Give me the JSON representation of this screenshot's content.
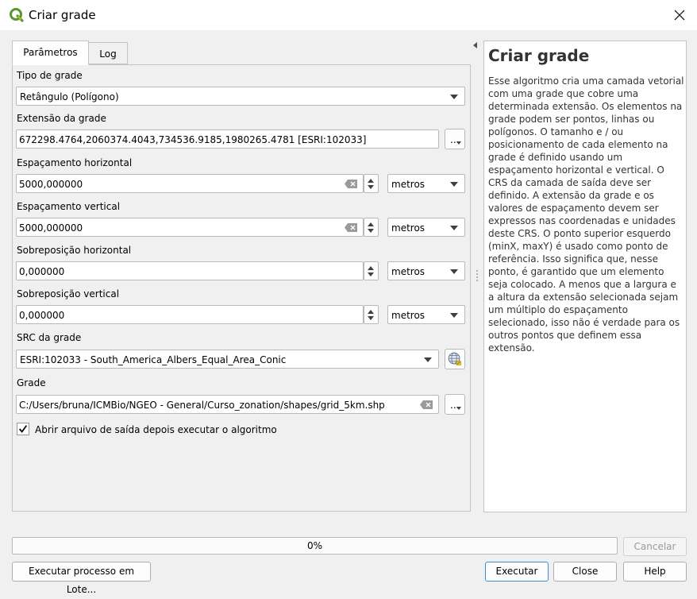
{
  "window": {
    "title": "Criar grade"
  },
  "tabs": [
    {
      "label": "Parâmetros"
    },
    {
      "label": "Log"
    }
  ],
  "params": {
    "grid_type": {
      "label": "Tipo de grade",
      "value": "Retângulo (Polígono)"
    },
    "extent": {
      "label": "Extensão da grade",
      "value": "672298.4764,2060374.4043,734536.9185,1980265.4781 [ESRI:102033]",
      "button": "..."
    },
    "h_spacing": {
      "label": "Espaçamento horizontal",
      "value": "5000,000000",
      "unit": "metros"
    },
    "v_spacing": {
      "label": "Espaçamento vertical",
      "value": "5000,000000",
      "unit": "metros"
    },
    "h_overlay": {
      "label": "Sobreposição horizontal",
      "value": "0,000000",
      "unit": "metros"
    },
    "v_overlay": {
      "label": "Sobreposição vertical",
      "value": "0,000000",
      "unit": "metros"
    },
    "crs": {
      "label": "SRC da grade",
      "value": "ESRI:102033 - South_America_Albers_Equal_Area_Conic"
    },
    "output": {
      "label": "Grade",
      "value": "C:/Users/bruna/ICMBio/NGEO - General/Curso_zonation/shapes/grid_5km.shp",
      "button": "..."
    },
    "open_output": {
      "label": "Abrir arquivo de saída depois executar o algoritmo",
      "checked": true
    }
  },
  "help": {
    "title": "Criar grade",
    "body": "Esse algoritmo cria uma camada vetorial com uma grade que cobre uma determinada extensão. Os elementos na grade podem ser pontos, linhas ou polígonos. O tamanho e / ou posicionamento de cada elemento na grade é definido usando um espaçamento horizontal e vertical. O CRS da camada de saída deve ser definido. A extensão da grade e os valores de espaçamento devem ser expressos nas coordenadas e unidades deste CRS. O ponto superior esquerdo (minX, maxY) é usado como ponto de referência. Isso significa que, nesse ponto, é garantido que um elemento seja colocado. A menos que a largura e a altura da extensão selecionada sejam um múltiplo do espaçamento selecionado, isso não é verdade para os outros pontos que definem essa extensão."
  },
  "progress": {
    "value": 0,
    "text": "0%"
  },
  "buttons": {
    "cancel": "Cancelar",
    "batch": "Executar processo em Lote...",
    "run": "Executar",
    "close": "Close",
    "help": "Help"
  },
  "colors": {
    "qgis_green": "#589632",
    "qgis_yellow": "#ee7913",
    "default_button_border": "#3c8fd6"
  }
}
